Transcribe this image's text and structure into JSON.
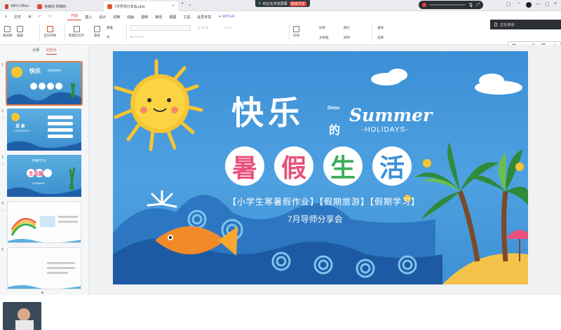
{
  "tabs": [
    {
      "label": "WPS Office",
      "color": "#d14424"
    },
    {
      "label": "亲嘴鸣 邦嘴鸣",
      "color": "#e04a3a"
    },
    {
      "label": "7月导师分享会.pptx",
      "color": "#e05a2a"
    }
  ],
  "share": {
    "text": "你正在共享屏幕",
    "stop": "结束共享"
  },
  "menu": {
    "file": "文件",
    "items": [
      "开始",
      "插入",
      "设计",
      "切换",
      "动画",
      "放映",
      "审阅",
      "视图",
      "工具",
      "会员专享"
    ],
    "wps_ai": "WPS AI"
  },
  "toolbar": {
    "format_painter": "格式刷",
    "paste": "粘贴",
    "play_from_current": "当页开始",
    "new_slide": "新建幻灯片",
    "layout": "版式",
    "section": "节",
    "reset": "重置",
    "shapes": "形状",
    "picture": "图片",
    "textbox": "文本框",
    "arrange": "排列",
    "find": "查找",
    "select": "选择"
  },
  "voice": {
    "text": "正在讲话:"
  },
  "ime": {
    "items": [
      "中",
      "♪",
      "•°",
      "简",
      "☺"
    ]
  },
  "left_panel": {
    "tab_outline": "大纲",
    "tab_slides": "幻灯片",
    "slide_numbers": [
      "1",
      "2",
      "3",
      "4",
      "5"
    ]
  },
  "slide": {
    "title_kl": "快乐",
    "title_de": "的",
    "brand": "Doox",
    "summer": "Summer",
    "holidays": "-HOLIDAYS-",
    "chars": [
      "暑",
      "假",
      "生",
      "活"
    ],
    "char_colors": [
      "#e8507a",
      "#e8507a",
      "#3dae5a",
      "#3b90d8"
    ],
    "subtitle": "【小学生寒暑假作业】【假期旅游】【假期学习】",
    "share_title": "7月导师分享会"
  },
  "thumbs": {
    "t1_title": "快乐",
    "t1_summer": "Summer",
    "t2_text": "目 录",
    "t2_sub": "CONTENTS",
    "t3_part": "PART 01",
    "t3_title": "生活篇",
    "t3_summer": "SUMMER"
  },
  "colors": {
    "accent": "#d14424",
    "slide_bg": "#4ea1e0",
    "sun": "#f7c531"
  }
}
